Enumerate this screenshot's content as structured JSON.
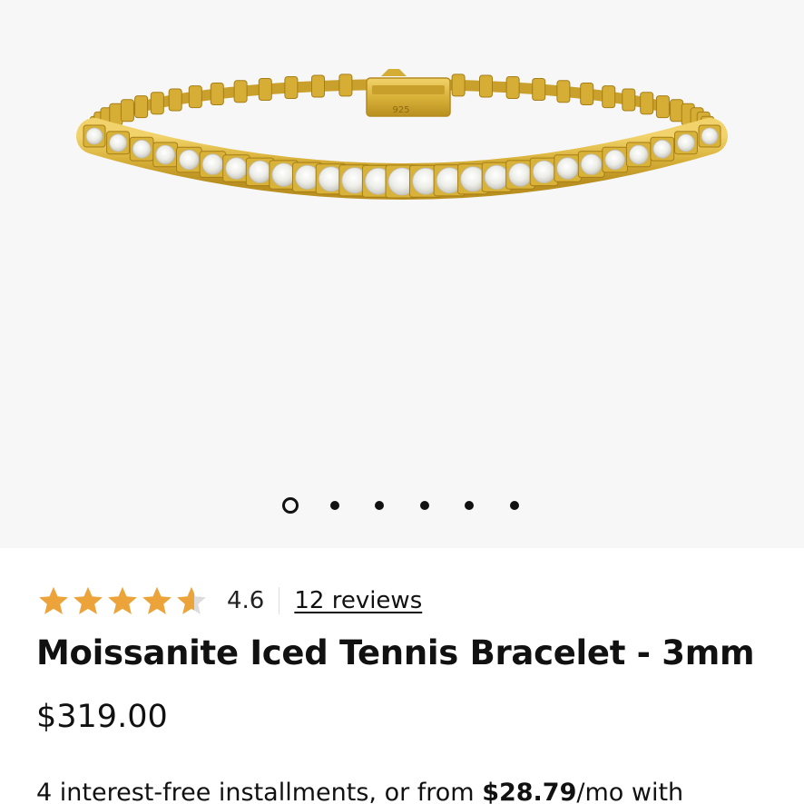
{
  "gallery": {
    "image_alt": "Moissanite Iced Tennis Bracelet - 3mm",
    "clasp_engraving": "925",
    "slide_count": 6,
    "active_slide": 1
  },
  "rating": {
    "value": "4.6",
    "stars_filled": 4.6,
    "reviews_label": "12 reviews"
  },
  "product": {
    "title": "Moissanite Iced Tennis Bracelet - 3mm",
    "price": "$319.00"
  },
  "installments": {
    "prefix": "4 interest-free installments, or from ",
    "amount": "$28.79",
    "suffix": "/mo with"
  },
  "colors": {
    "gallery_bg": "#f7f7f8",
    "star_gold": "#eca339",
    "star_empty": "#dcdcdc",
    "metal_gold": "#d9b23a",
    "stone_white": "#eeeeea"
  }
}
